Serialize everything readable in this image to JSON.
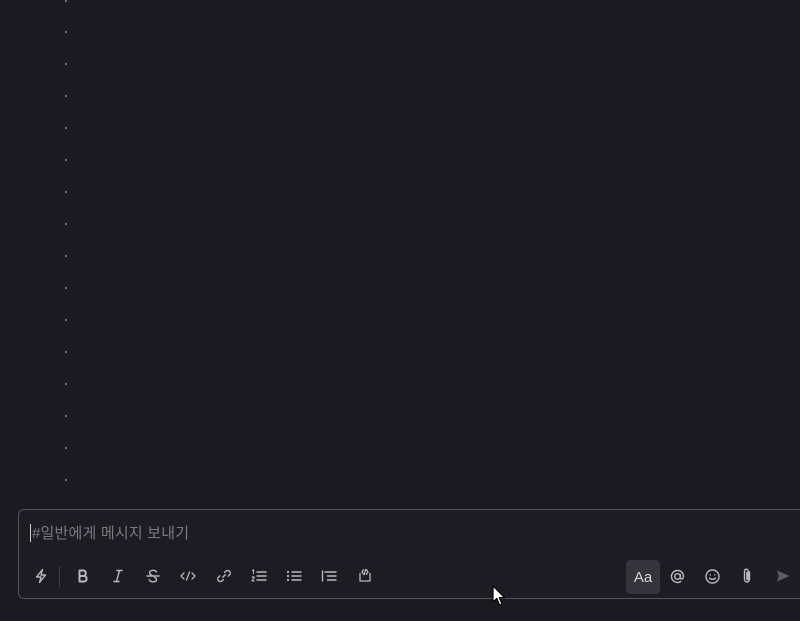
{
  "composer": {
    "placeholder": "#일반에게 메시지 보내기",
    "format_toggle_label": "Aa"
  },
  "toolbar": {
    "left_icons": [
      "lightning-icon",
      "bold-icon",
      "italic-icon",
      "strikethrough-icon",
      "code-icon",
      "link-icon",
      "ordered-list-icon",
      "bulleted-list-icon",
      "indent-list-icon",
      "code-block-icon"
    ],
    "right_icons": [
      "mention-icon",
      "emoji-icon",
      "attachment-icon",
      "send-icon"
    ],
    "send_enabled": false
  },
  "colors": {
    "background": "#1b1a21",
    "composer_border": "#55545b",
    "placeholder": "#7b7a80",
    "icon": "#b9b8be",
    "active_button_bg": "#35343b"
  }
}
